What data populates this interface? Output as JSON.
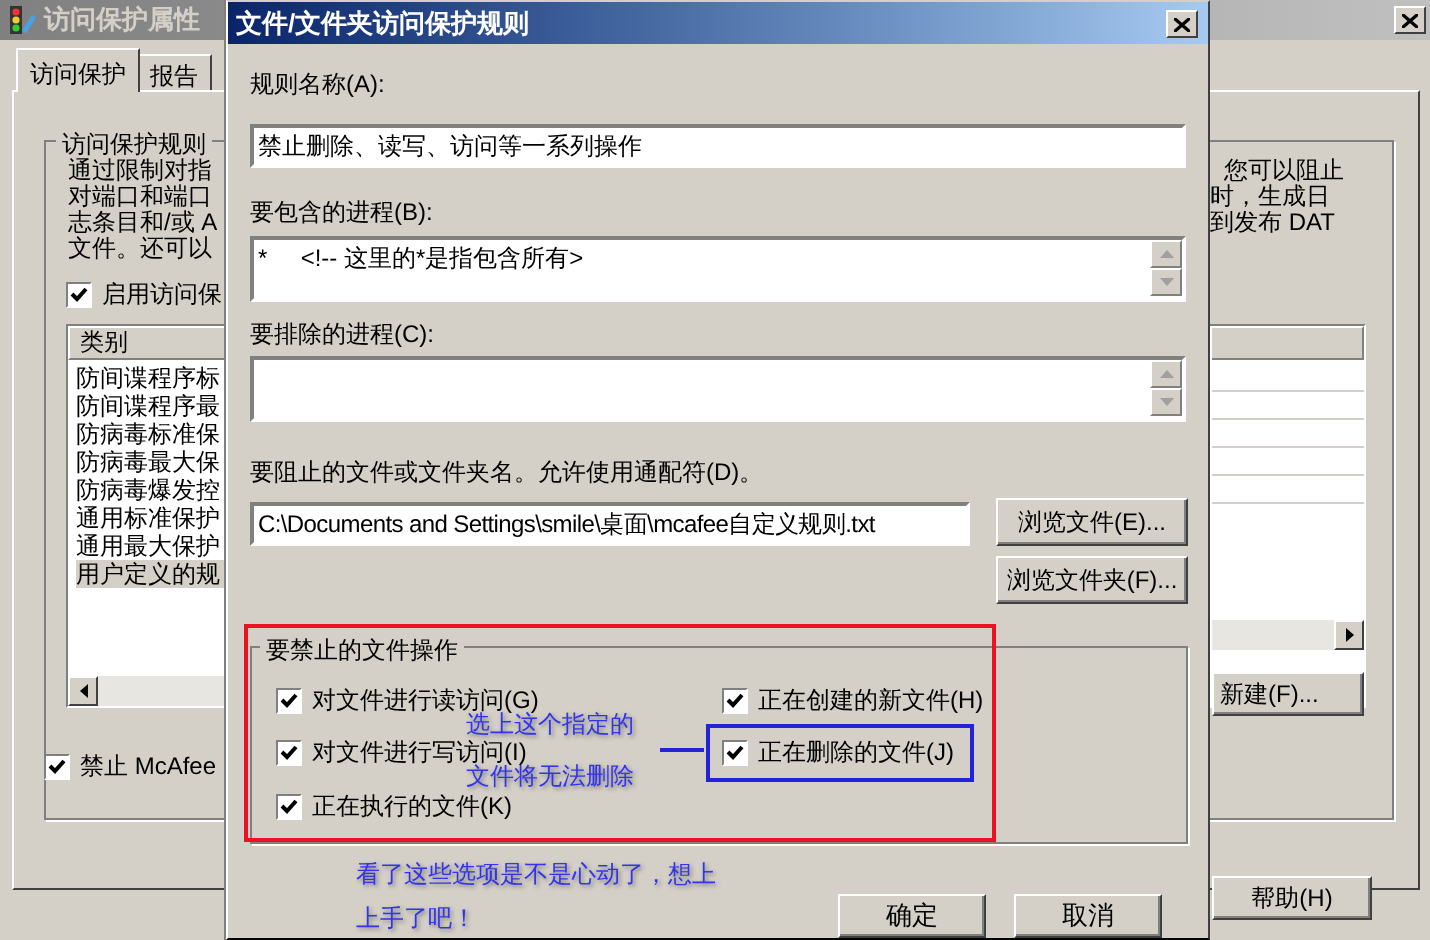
{
  "background_window": {
    "title": "访问保护属性",
    "tabs": [
      {
        "label": "访问保护",
        "selected": true
      },
      {
        "label": "报告",
        "selected": false
      }
    ],
    "group_title": "访问保护规则",
    "description_left": [
      "通过限制对指",
      "对端口和端口",
      "志条目和/或 A",
      "文件。还可以"
    ],
    "description_right": [
      "您可以阻止",
      "时，生成日",
      "到发布 DAT"
    ],
    "enable_checkbox": {
      "label": "启用访问保",
      "checked": true
    },
    "list_header": "类别",
    "list_items": [
      {
        "label": "防间谍程序标",
        "selected": false
      },
      {
        "label": "防间谍程序最",
        "selected": false
      },
      {
        "label": "防病毒标准保",
        "selected": false
      },
      {
        "label": "防病毒最大保",
        "selected": false
      },
      {
        "label": "防病毒爆发控",
        "selected": false
      },
      {
        "label": "通用标准保护",
        "selected": false
      },
      {
        "label": "通用最大保护",
        "selected": false
      },
      {
        "label": "用户定义的规",
        "selected": true
      }
    ],
    "new_button": "新建(F)...",
    "block_checkbox": {
      "label": "禁止 McAfee",
      "checked": true
    },
    "help_button": "帮助(H)"
  },
  "dialog": {
    "title": "文件/文件夹访问保护规则",
    "rule_name": {
      "label": "规则名称(A):",
      "value": "禁止删除、读写、访问等一系列操作"
    },
    "include_processes": {
      "label": "要包含的进程(B):",
      "value": "*     <!-- 这里的*是指包含所有>"
    },
    "exclude_processes": {
      "label": "要排除的进程(C):"
    },
    "blocked_path": {
      "label": "要阻止的文件或文件夹名。允许使用通配符(D)。",
      "value": "C:\\Documents and Settings\\smile\\桌面\\mcafee自定义规则.txt"
    },
    "browse_file_button": "浏览文件(E)...",
    "browse_folder_button": "浏览文件夹(F)...",
    "operations": {
      "title": "要禁止的文件操作",
      "items": [
        {
          "label": "对文件进行读访问(G)",
          "checked": true
        },
        {
          "label": "对文件进行写访问(I)",
          "checked": true
        },
        {
          "label": "正在执行的文件(K)",
          "checked": true
        },
        {
          "label": "正在创建的新文件(H)",
          "checked": true
        },
        {
          "label": "正在删除的文件(J)",
          "checked": true
        }
      ]
    },
    "ok_button": "确定",
    "cancel_button": "取消"
  },
  "annotations": {
    "callout": [
      "选上这个指定的",
      "文件将无法删除"
    ],
    "comment": [
      "看了这些选项是不是心动了，想上",
      "上手了吧！"
    ]
  }
}
